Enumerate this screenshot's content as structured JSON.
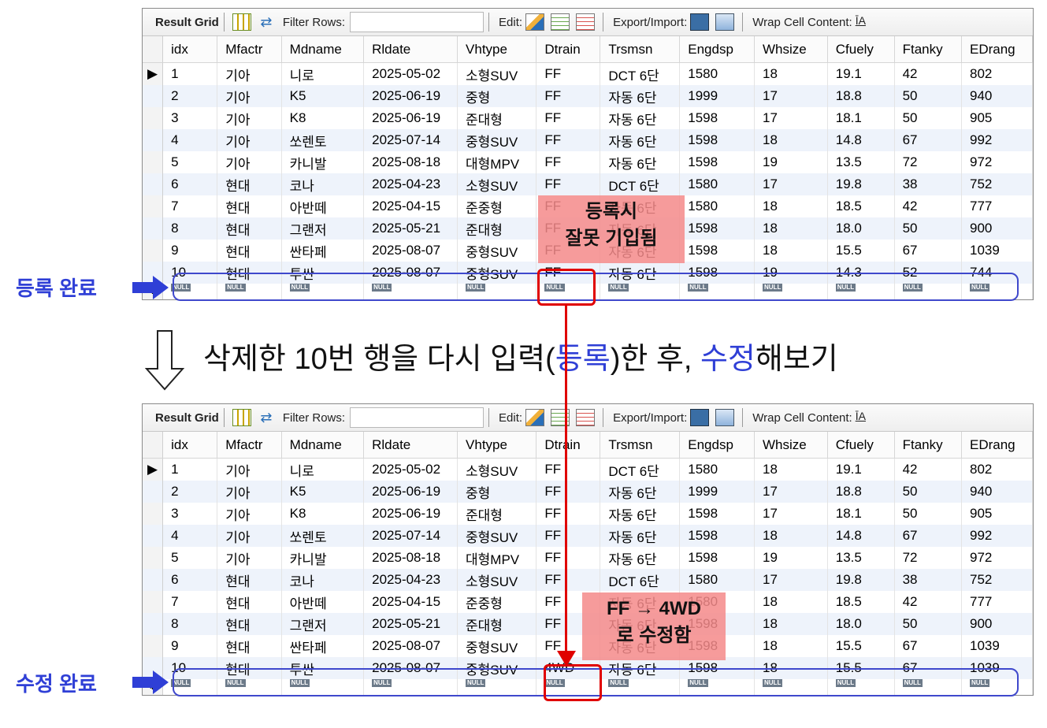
{
  "toolbar": {
    "result_grid": "Result Grid",
    "filter_rows": "Filter Rows:",
    "edit": "Edit:",
    "export_import": "Export/Import:",
    "wrap_cell": "Wrap Cell Content:"
  },
  "columns": [
    "idx",
    "Mfactr",
    "Mdname",
    "Rldate",
    "Vhtype",
    "Dtrain",
    "Trsmsn",
    "Engdsp",
    "Whsize",
    "Cfuely",
    "Ftanky",
    "EDrang"
  ],
  "null_label": "NULL",
  "grid_top_rows": [
    [
      "1",
      "기아",
      "니로",
      "2025-05-02",
      "소형SUV",
      "FF",
      "DCT 6단",
      "1580",
      "18",
      "19.1",
      "42",
      "802"
    ],
    [
      "2",
      "기아",
      "K5",
      "2025-06-19",
      "중형",
      "FF",
      "자동 6단",
      "1999",
      "17",
      "18.8",
      "50",
      "940"
    ],
    [
      "3",
      "기아",
      "K8",
      "2025-06-19",
      "준대형",
      "FF",
      "자동 6단",
      "1598",
      "17",
      "18.1",
      "50",
      "905"
    ],
    [
      "4",
      "기아",
      "쏘렌토",
      "2025-07-14",
      "중형SUV",
      "FF",
      "자동 6단",
      "1598",
      "18",
      "14.8",
      "67",
      "992"
    ],
    [
      "5",
      "기아",
      "카니발",
      "2025-08-18",
      "대형MPV",
      "FF",
      "자동 6단",
      "1598",
      "19",
      "13.5",
      "72",
      "972"
    ],
    [
      "6",
      "현대",
      "코나",
      "2025-04-23",
      "소형SUV",
      "FF",
      "DCT 6단",
      "1580",
      "17",
      "19.8",
      "38",
      "752"
    ],
    [
      "7",
      "현대",
      "아반떼",
      "2025-04-15",
      "준중형",
      "FF",
      "자동 6단",
      "1580",
      "18",
      "18.5",
      "42",
      "777"
    ],
    [
      "8",
      "현대",
      "그랜저",
      "2025-05-21",
      "준대형",
      "FF",
      "자동 6단",
      "1598",
      "18",
      "18.0",
      "50",
      "900"
    ],
    [
      "9",
      "현대",
      "싼타페",
      "2025-08-07",
      "중형SUV",
      "FF",
      "자동 6단",
      "1598",
      "18",
      "15.5",
      "67",
      "1039"
    ],
    [
      "10",
      "현대",
      "투싼",
      "2025-08-07",
      "중형SUV",
      "FF",
      "자동 6단",
      "1598",
      "19",
      "14.3",
      "52",
      "744"
    ]
  ],
  "grid_bottom_rows": [
    [
      "1",
      "기아",
      "니로",
      "2025-05-02",
      "소형SUV",
      "FF",
      "DCT 6단",
      "1580",
      "18",
      "19.1",
      "42",
      "802"
    ],
    [
      "2",
      "기아",
      "K5",
      "2025-06-19",
      "중형",
      "FF",
      "자동 6단",
      "1999",
      "17",
      "18.8",
      "50",
      "940"
    ],
    [
      "3",
      "기아",
      "K8",
      "2025-06-19",
      "준대형",
      "FF",
      "자동 6단",
      "1598",
      "17",
      "18.1",
      "50",
      "905"
    ],
    [
      "4",
      "기아",
      "쏘렌토",
      "2025-07-14",
      "중형SUV",
      "FF",
      "자동 6단",
      "1598",
      "18",
      "14.8",
      "67",
      "992"
    ],
    [
      "5",
      "기아",
      "카니발",
      "2025-08-18",
      "대형MPV",
      "FF",
      "자동 6단",
      "1598",
      "19",
      "13.5",
      "72",
      "972"
    ],
    [
      "6",
      "현대",
      "코나",
      "2025-04-23",
      "소형SUV",
      "FF",
      "DCT 6단",
      "1580",
      "17",
      "19.8",
      "38",
      "752"
    ],
    [
      "7",
      "현대",
      "아반떼",
      "2025-04-15",
      "준중형",
      "FF",
      "자동 6단",
      "1580",
      "18",
      "18.5",
      "42",
      "777"
    ],
    [
      "8",
      "현대",
      "그랜저",
      "2025-05-21",
      "준대형",
      "FF",
      "자동 6단",
      "1598",
      "18",
      "18.0",
      "50",
      "900"
    ],
    [
      "9",
      "현대",
      "싼타페",
      "2025-08-07",
      "중형SUV",
      "FF",
      "자동 6단",
      "1598",
      "18",
      "15.5",
      "67",
      "1039"
    ],
    [
      "10",
      "현대",
      "투싼",
      "2025-08-07",
      "중형SUV",
      "4WD",
      "자동 6단",
      "1598",
      "18",
      "15.5",
      "67",
      "1039"
    ]
  ],
  "labels": {
    "registered": "등록 완료",
    "modified": "수정 완료",
    "instruction_1": "삭제한 10번 행을 다시 입력(",
    "instruction_reg": "등록",
    "instruction_2": ")한 후, ",
    "instruction_mod": "수정",
    "instruction_3": "해보기",
    "note_top_line1": "등록시",
    "note_top_line2": "잘못 기입됨",
    "note_bottom_line1": "FF → 4WD",
    "note_bottom_line2": "로 수정함"
  },
  "colors": {
    "accent_blue": "#2f3fd6",
    "highlight_red": "#e00000",
    "note_bg": "#f48a8a"
  }
}
